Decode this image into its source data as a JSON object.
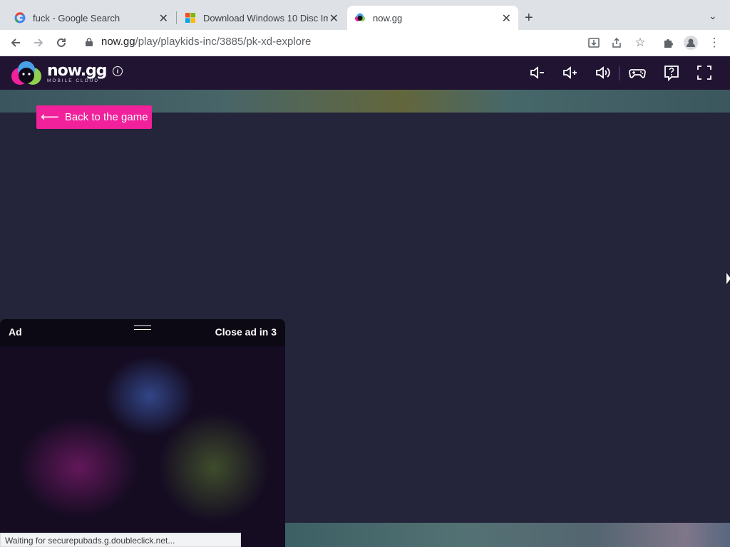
{
  "browser": {
    "tabs": [
      {
        "title": "fuck - Google Search",
        "icon": "google-icon",
        "active": false
      },
      {
        "title": "Download Windows 10 Disc Im",
        "icon": "microsoft-icon",
        "active": false
      },
      {
        "title": "now.gg",
        "icon": "nowgg-icon",
        "active": true
      }
    ],
    "url_host": "now.gg",
    "url_path": "/play/playkids-inc/3885/pk-xd-explore",
    "status_text": "Waiting for securepubads.g.doubleclick.net..."
  },
  "app": {
    "logo_text_now": "now",
    "logo_text_gg": ".gg",
    "logo_subtext": "MOBILE CLOUD",
    "back_button": "Back to the game",
    "controls": [
      "volume-down-icon",
      "volume-up-icon",
      "volume-icon",
      "gamepad-icon",
      "help-icon",
      "fullscreen-icon"
    ],
    "accent_color": "#f0219a"
  },
  "ad": {
    "label": "Ad",
    "close_text": "Close ad in 3"
  }
}
